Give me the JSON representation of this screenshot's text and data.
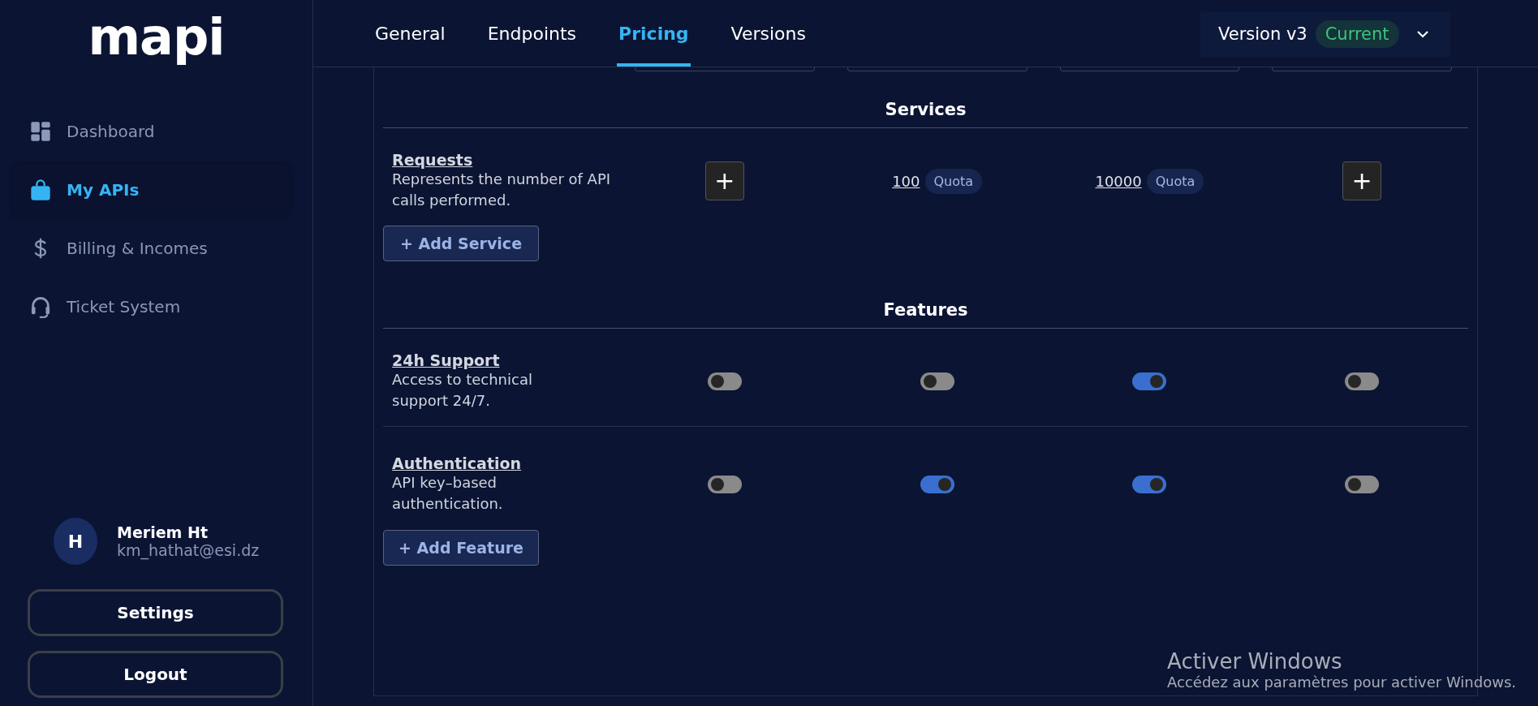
{
  "logo": "mapi",
  "sidebar": {
    "items": [
      {
        "label": "Dashboard",
        "selected": false
      },
      {
        "label": "My APIs",
        "selected": true
      },
      {
        "label": "Billing & Incomes",
        "selected": false
      },
      {
        "label": "Ticket System",
        "selected": false
      }
    ]
  },
  "user": {
    "initial": "H",
    "name": "Meriem Ht",
    "email": "km_hathat@esi.dz"
  },
  "sidebar_buttons": [
    "Settings",
    "Logout"
  ],
  "tabs": [
    {
      "label": "General",
      "selected": false
    },
    {
      "label": "Endpoints",
      "selected": false
    },
    {
      "label": "Pricing",
      "selected": true
    },
    {
      "label": "Versions",
      "selected": false
    }
  ],
  "version": {
    "label": "Version v3",
    "badge": "Current"
  },
  "sections": [
    {
      "title": "Services",
      "rows": [
        {
          "name": "Requests",
          "description": [
            "Represents the number of API",
            "calls performed."
          ],
          "cells": [
            {
              "kind": "add",
              "label": "+"
            },
            {
              "kind": "quota",
              "value": "100",
              "badge": "Quota"
            },
            {
              "kind": "quota",
              "value": "10000",
              "badge": "Quota"
            },
            {
              "kind": "add",
              "label": "+"
            }
          ]
        }
      ],
      "add_button": "+ Add Service"
    },
    {
      "title": "Features",
      "rows": [
        {
          "name": "24h Support",
          "description": [
            "Access to technical",
            "support 24/7."
          ],
          "cells": [
            {
              "kind": "toggle",
              "on": false
            },
            {
              "kind": "toggle",
              "on": false
            },
            {
              "kind": "toggle",
              "on": true
            },
            {
              "kind": "toggle",
              "on": false
            }
          ]
        },
        {
          "name": "Authentication",
          "description": [
            "API key–based",
            "authentication."
          ],
          "cells": [
            {
              "kind": "toggle",
              "on": false
            },
            {
              "kind": "toggle",
              "on": true
            },
            {
              "kind": "toggle",
              "on": true
            },
            {
              "kind": "toggle",
              "on": false
            }
          ]
        }
      ],
      "add_button": "+ Add Feature"
    }
  ],
  "os_notice": {
    "title": "Activer Windows",
    "text": "Accédez aux paramètres pour activer Windows."
  }
}
